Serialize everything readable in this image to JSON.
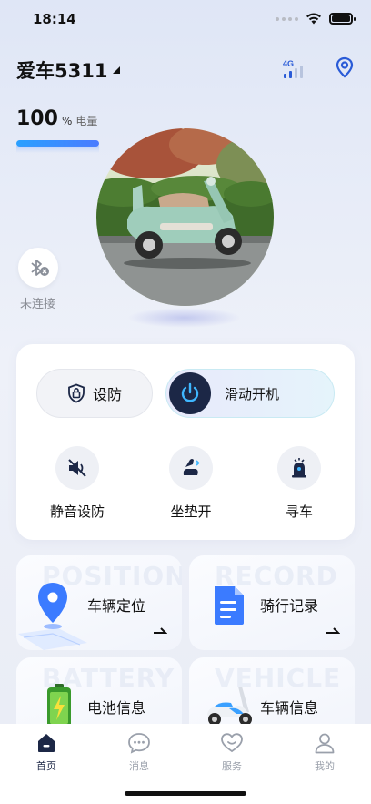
{
  "status_bar": {
    "time": "18:14"
  },
  "header": {
    "vehicle_name": "爱车5311",
    "network_label": "4G"
  },
  "battery": {
    "percent": "100",
    "unit": "%",
    "label": "电量",
    "level": 1.0
  },
  "bluetooth": {
    "status": "未连接"
  },
  "controls": {
    "arm_label": "设防",
    "slide_label": "滑动开机",
    "quick_actions": [
      {
        "label": "静音设防",
        "icon": "mute-arm-icon"
      },
      {
        "label": "坐垫开",
        "icon": "seat-open-icon"
      },
      {
        "label": "寻车",
        "icon": "find-car-icon"
      }
    ]
  },
  "features": [
    {
      "watermark": "POSITION",
      "title": "车辆定位",
      "icon": "map-pin-icon"
    },
    {
      "watermark": "RECORD",
      "title": "骑行记录",
      "icon": "document-icon"
    },
    {
      "watermark": "BATTERY",
      "title": "电池信息",
      "icon": "battery-icon"
    },
    {
      "watermark": "VEHICLE",
      "title": "车辆信息",
      "icon": "scooter-icon"
    }
  ],
  "tabbar": {
    "items": [
      {
        "label": "首页",
        "active": true
      },
      {
        "label": "消息",
        "active": false
      },
      {
        "label": "服务",
        "active": false
      },
      {
        "label": "我的",
        "active": false
      }
    ]
  },
  "colors": {
    "accent": "#1c2746",
    "battery_bar": "#3a8cff",
    "power_ring": "#3fb7ff"
  }
}
